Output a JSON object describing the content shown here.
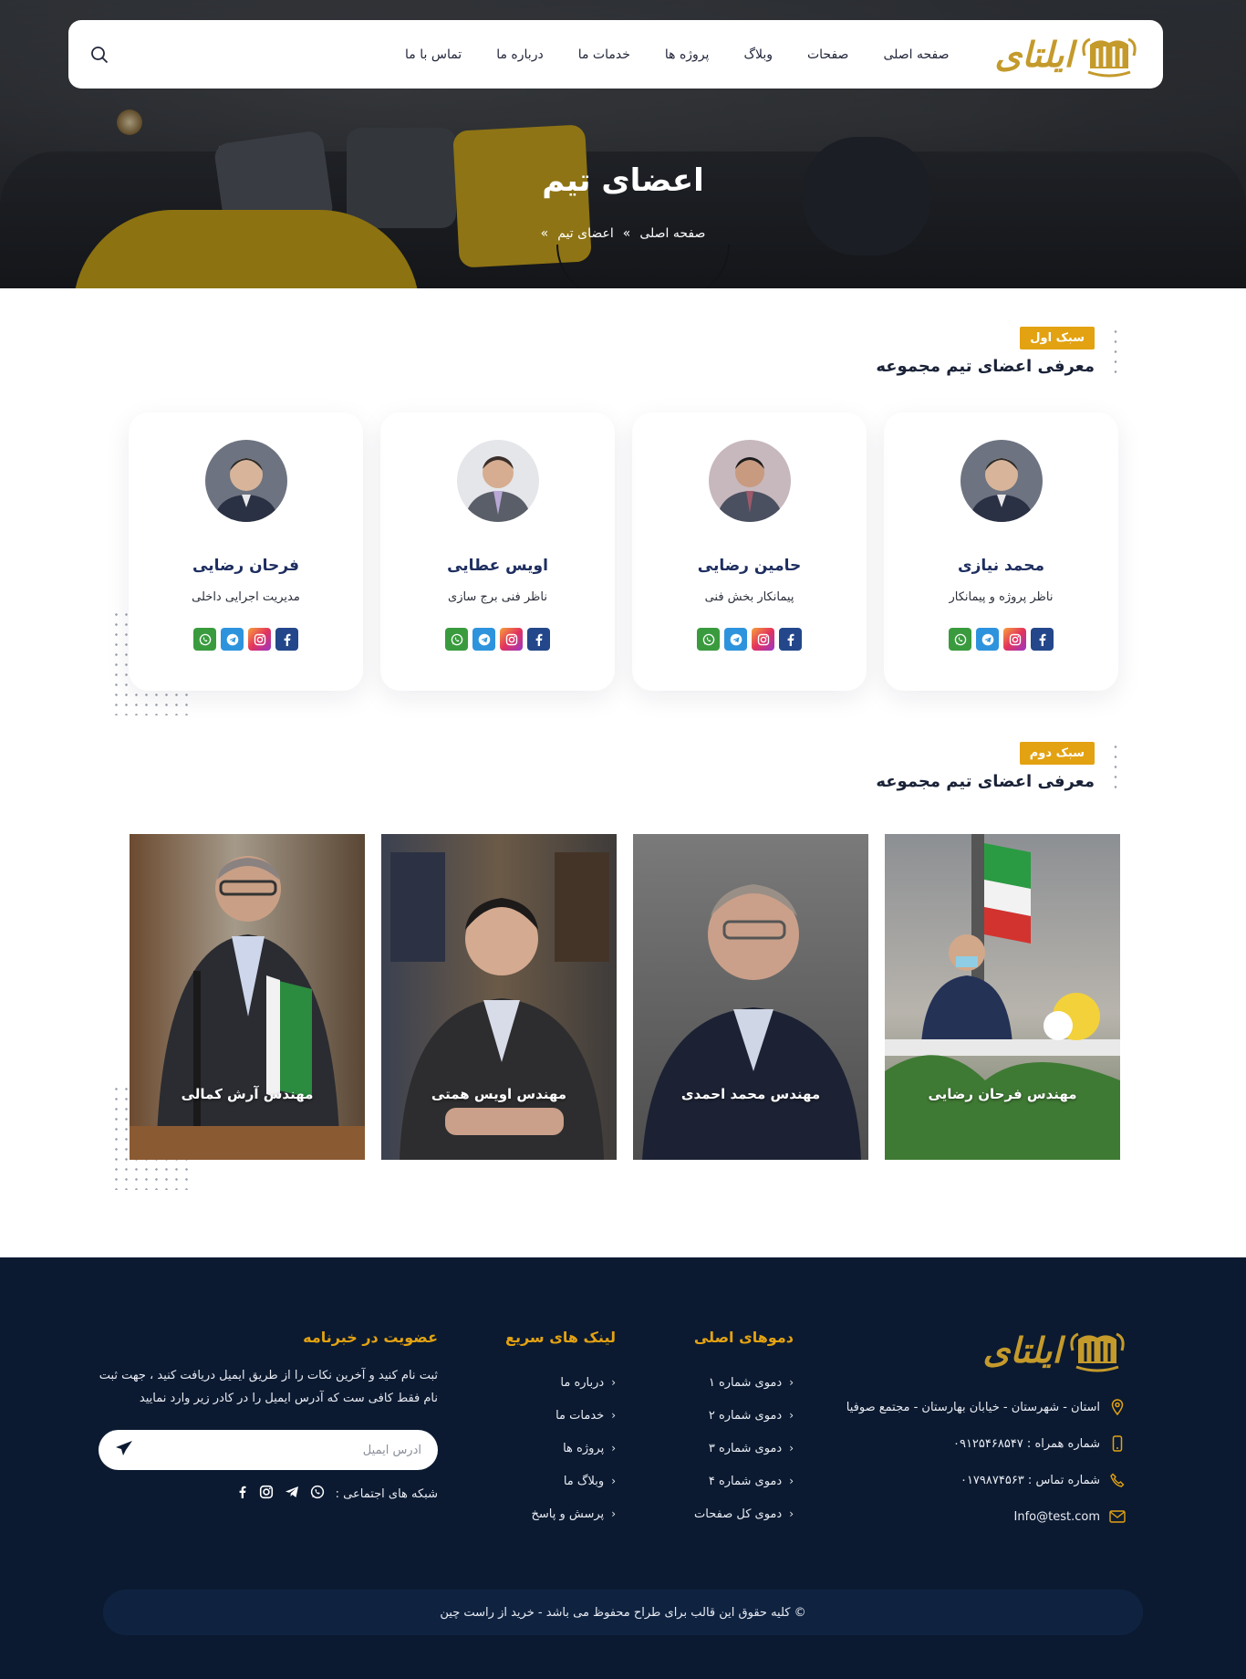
{
  "header": {
    "logo_text": "ایلتای",
    "nav": [
      "صفحه اصلی",
      "صفحات",
      "وبلاگ",
      "پروژه ها",
      "خدمات ما",
      "درباره ما",
      "تماس با ما"
    ]
  },
  "hero": {
    "title": "اعضای تیم",
    "breadcrumb": [
      "صفحه اصلی",
      "»",
      "اعضای تیم",
      "»"
    ]
  },
  "section1": {
    "tag": "سبک اول",
    "title": "معرفی اعضای تیم مجموعه",
    "members": [
      {
        "name": "محمد نیازی",
        "role": "ناظر پروژه و پیمانکار"
      },
      {
        "name": "حامین رضایی",
        "role": "پیمانکار بخش فنی"
      },
      {
        "name": "اویس عطایی",
        "role": "ناظر فنی برج سازی"
      },
      {
        "name": "فرحان رضایی",
        "role": "مدیریت اجرایی داخلی"
      }
    ],
    "social_icons": [
      "whatsapp-icon",
      "telegram-icon",
      "instagram-icon",
      "facebook-icon"
    ]
  },
  "section2": {
    "tag": "سبک دوم",
    "title": "معرفی اعضای تیم مجموعه",
    "members": [
      {
        "name": "مهندس فرحان رضایی"
      },
      {
        "name": "مهندس محمد احمدی"
      },
      {
        "name": "مهندس اویس همتی"
      },
      {
        "name": "مهندس آرش کمالی"
      }
    ]
  },
  "footer": {
    "logo_text": "ایلتای",
    "contact": {
      "address": "استان - شهرستان - خیابان بهارستان - مجتمع صوفیا",
      "mobile": "شماره همراه : ۰۹۱۲۵۴۶۸۵۴۷",
      "phone": "شماره تماس : ۰۱۷۹۸۷۴۵۶۳",
      "email": "Info@test.com"
    },
    "demos": {
      "title": "دموهای اصلی",
      "items": [
        "دموی شماره ۱",
        "دموی شماره ۲",
        "دموی شماره ۳",
        "دموی شماره ۴",
        "دموی کل صفحات"
      ]
    },
    "quick_links": {
      "title": "لینک های سریع",
      "items": [
        "درباره ما",
        "خدمات ما",
        "پروژه ها",
        "وبلاگ ما",
        "پرسش و پاسخ"
      ]
    },
    "newsletter": {
      "title": "عضویت در خبرنامه",
      "text": "ثبت نام کنید و آخرین نکات را از طریق ایمیل دریافت کنید ، جهت ثبت نام فقط کافی ست که آدرس ایمیل را در کادر زیر وارد نمایید",
      "placeholder": "آدرس ایمیل",
      "social_label": "شبکه های اجتماعی :"
    },
    "copyright": "© کلیه حقوق این قالب برای طراح محفوظ می باشد -  خرید از راست چین"
  },
  "colors": {
    "accent": "#e3a212",
    "navy": "#0b1a31",
    "name_blue": "#1e2e60"
  }
}
